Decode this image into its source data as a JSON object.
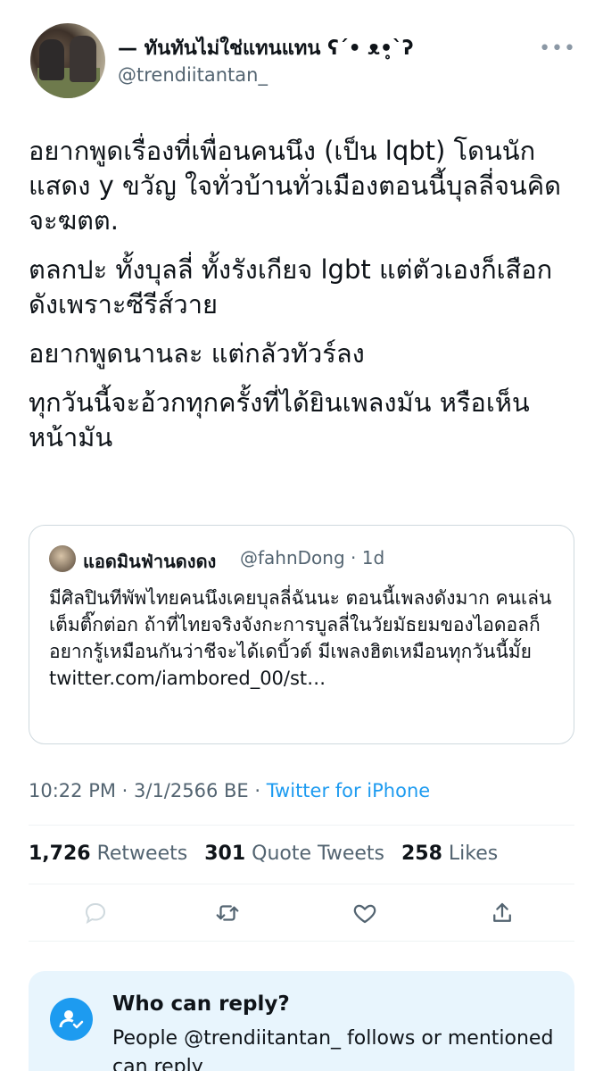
{
  "author": {
    "display_name": "— ทันทันไม่ใช่แทนแทน ʕ´• ᴥ•̥`ʔ",
    "handle": "@trendiitantan_"
  },
  "tweet": {
    "paragraphs": [
      "อยากพูดเรื่องที่เพื่อนคนนึง (เป็น lqbt) โดนนักแสดง y ขวัญ ใจทั่วบ้านทั่วเมืองตอนนี้บุลลี่จนคิดจะฆตต.",
      "ตลกปะ ทั้งบุลลี่ ทั้งรังเกียจ lgbt แต่ตัวเองก็เสือกดังเพราะซีรีส์วาย",
      "อยากพูดนานละ แต่กลัวทัวร์ลง",
      "ทุกวันนี้จะอ้วกทุกครั้งที่ได้ยินเพลงมัน หรือเห็นหน้ามัน"
    ]
  },
  "quote": {
    "name": "แอดมินฟ่านดงดง",
    "meta": "@fahnDong · 1d",
    "text": "มีศิลปินทีพัพไทยคนนึงเคยบุลลี่ฉันนะ ตอนนี้เพลงดังมาก คนเล่นเต็มติ๊กต่อก ถ้าที่ไทยจริงจังกะการบูลลี่ในวัยมัธยมของไอดอลก็อยากรู้เหมือนกันว่าชีจะได้เดบิ้วต์ มีเพลงฮิตเหมือนทุกวันนี้มั้ย twitter.com/iambored_00/st…"
  },
  "timestamp": {
    "time_date": "10:22 PM · 3/1/2566 BE · ",
    "source": "Twitter for iPhone"
  },
  "stats": {
    "retweets_count": "1,726",
    "retweets_label": "Retweets",
    "quotes_count": "301",
    "quotes_label": "Quote Tweets",
    "likes_count": "258",
    "likes_label": "Likes"
  },
  "actions": {
    "icons": [
      "reply-icon",
      "retweet-icon",
      "like-icon",
      "share-icon"
    ]
  },
  "reply_settings": {
    "title": "Who can reply?",
    "description": "People @trendiitantan_ follows or mentioned can reply"
  },
  "colors": {
    "accent": "#1d9bf0",
    "secondary_text": "#536471",
    "primary_text": "#0f1419",
    "reply_box_bg": "#e8f5fd"
  }
}
